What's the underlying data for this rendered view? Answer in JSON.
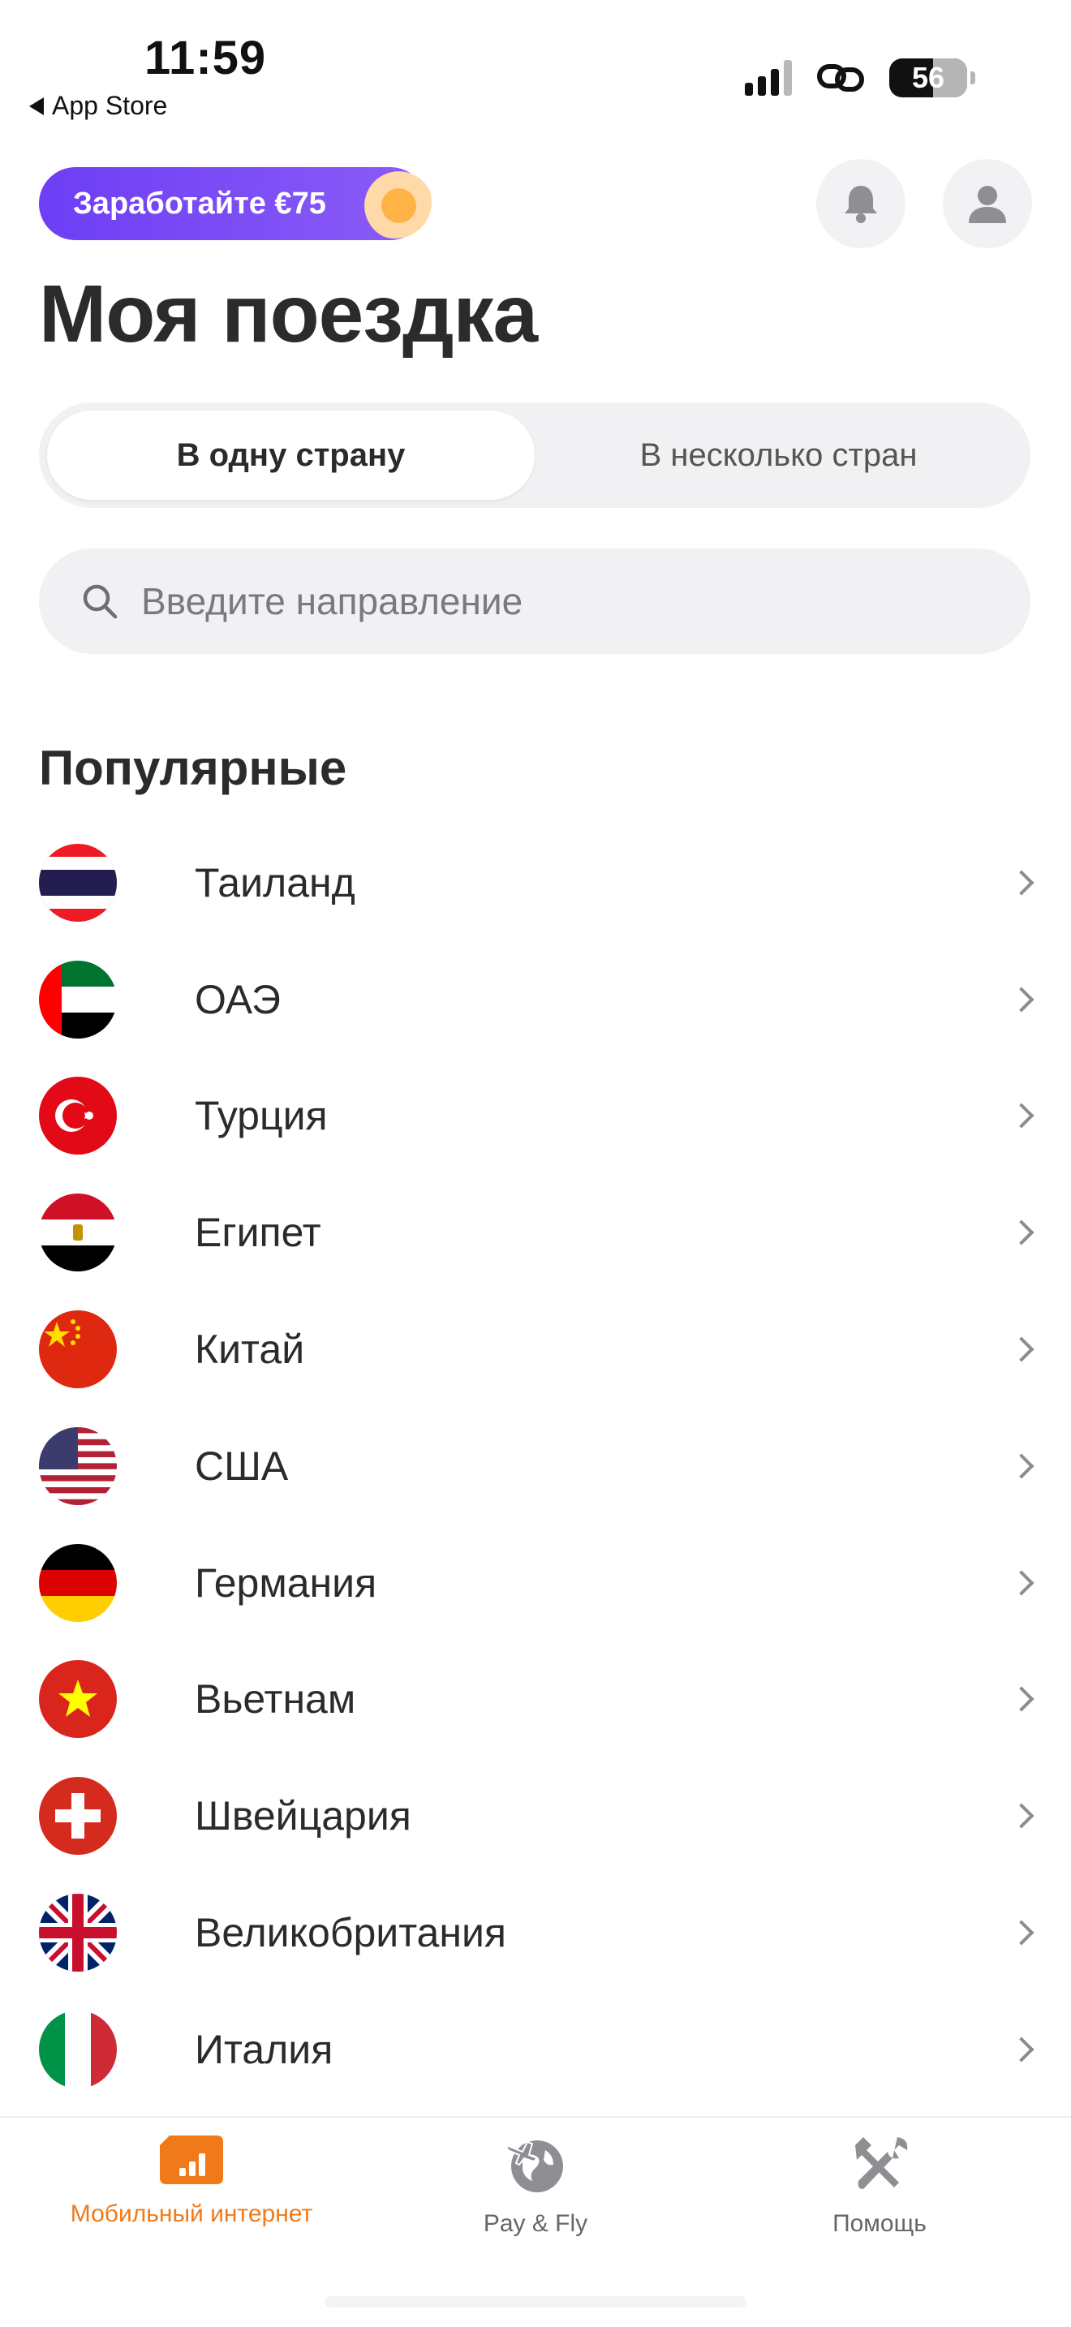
{
  "status_bar": {
    "time": "11:59",
    "back_label": "App Store",
    "battery": "56"
  },
  "header": {
    "promo_label": "Заработайте €75",
    "title": "Моя поездка"
  },
  "segmented": {
    "options": [
      "В одну страну",
      "В несколько стран"
    ],
    "selected": "В одну страну"
  },
  "search": {
    "placeholder": "Введите направление",
    "value": ""
  },
  "popular": {
    "title": "Популярные",
    "countries": [
      {
        "name": "Таиланд",
        "flag": "thailand-flag-icon"
      },
      {
        "name": "ОАЭ",
        "flag": "uae-flag-icon"
      },
      {
        "name": "Турция",
        "flag": "turkey-flag-icon"
      },
      {
        "name": "Египет",
        "flag": "egypt-flag-icon"
      },
      {
        "name": "Китай",
        "flag": "china-flag-icon"
      },
      {
        "name": "США",
        "flag": "usa-flag-icon"
      },
      {
        "name": "Германия",
        "flag": "germany-flag-icon"
      },
      {
        "name": "Вьетнам",
        "flag": "vietnam-flag-icon"
      },
      {
        "name": "Швейцария",
        "flag": "switzerland-flag-icon"
      },
      {
        "name": "Великобритания",
        "flag": "uk-flag-icon"
      },
      {
        "name": "Италия",
        "flag": "italy-flag-icon"
      }
    ]
  },
  "tabbar": {
    "items": [
      {
        "label": "Мобильный интернет",
        "icon": "cellular-data-icon",
        "active": true
      },
      {
        "label": "Pay & Fly",
        "icon": "globe-plane-icon",
        "active": false
      },
      {
        "label": "Помощь",
        "icon": "tools-icon",
        "active": false
      }
    ]
  },
  "colors": {
    "accent": "#f07a1a",
    "promo": "#7445f5",
    "surface": "#f1f1f3"
  }
}
